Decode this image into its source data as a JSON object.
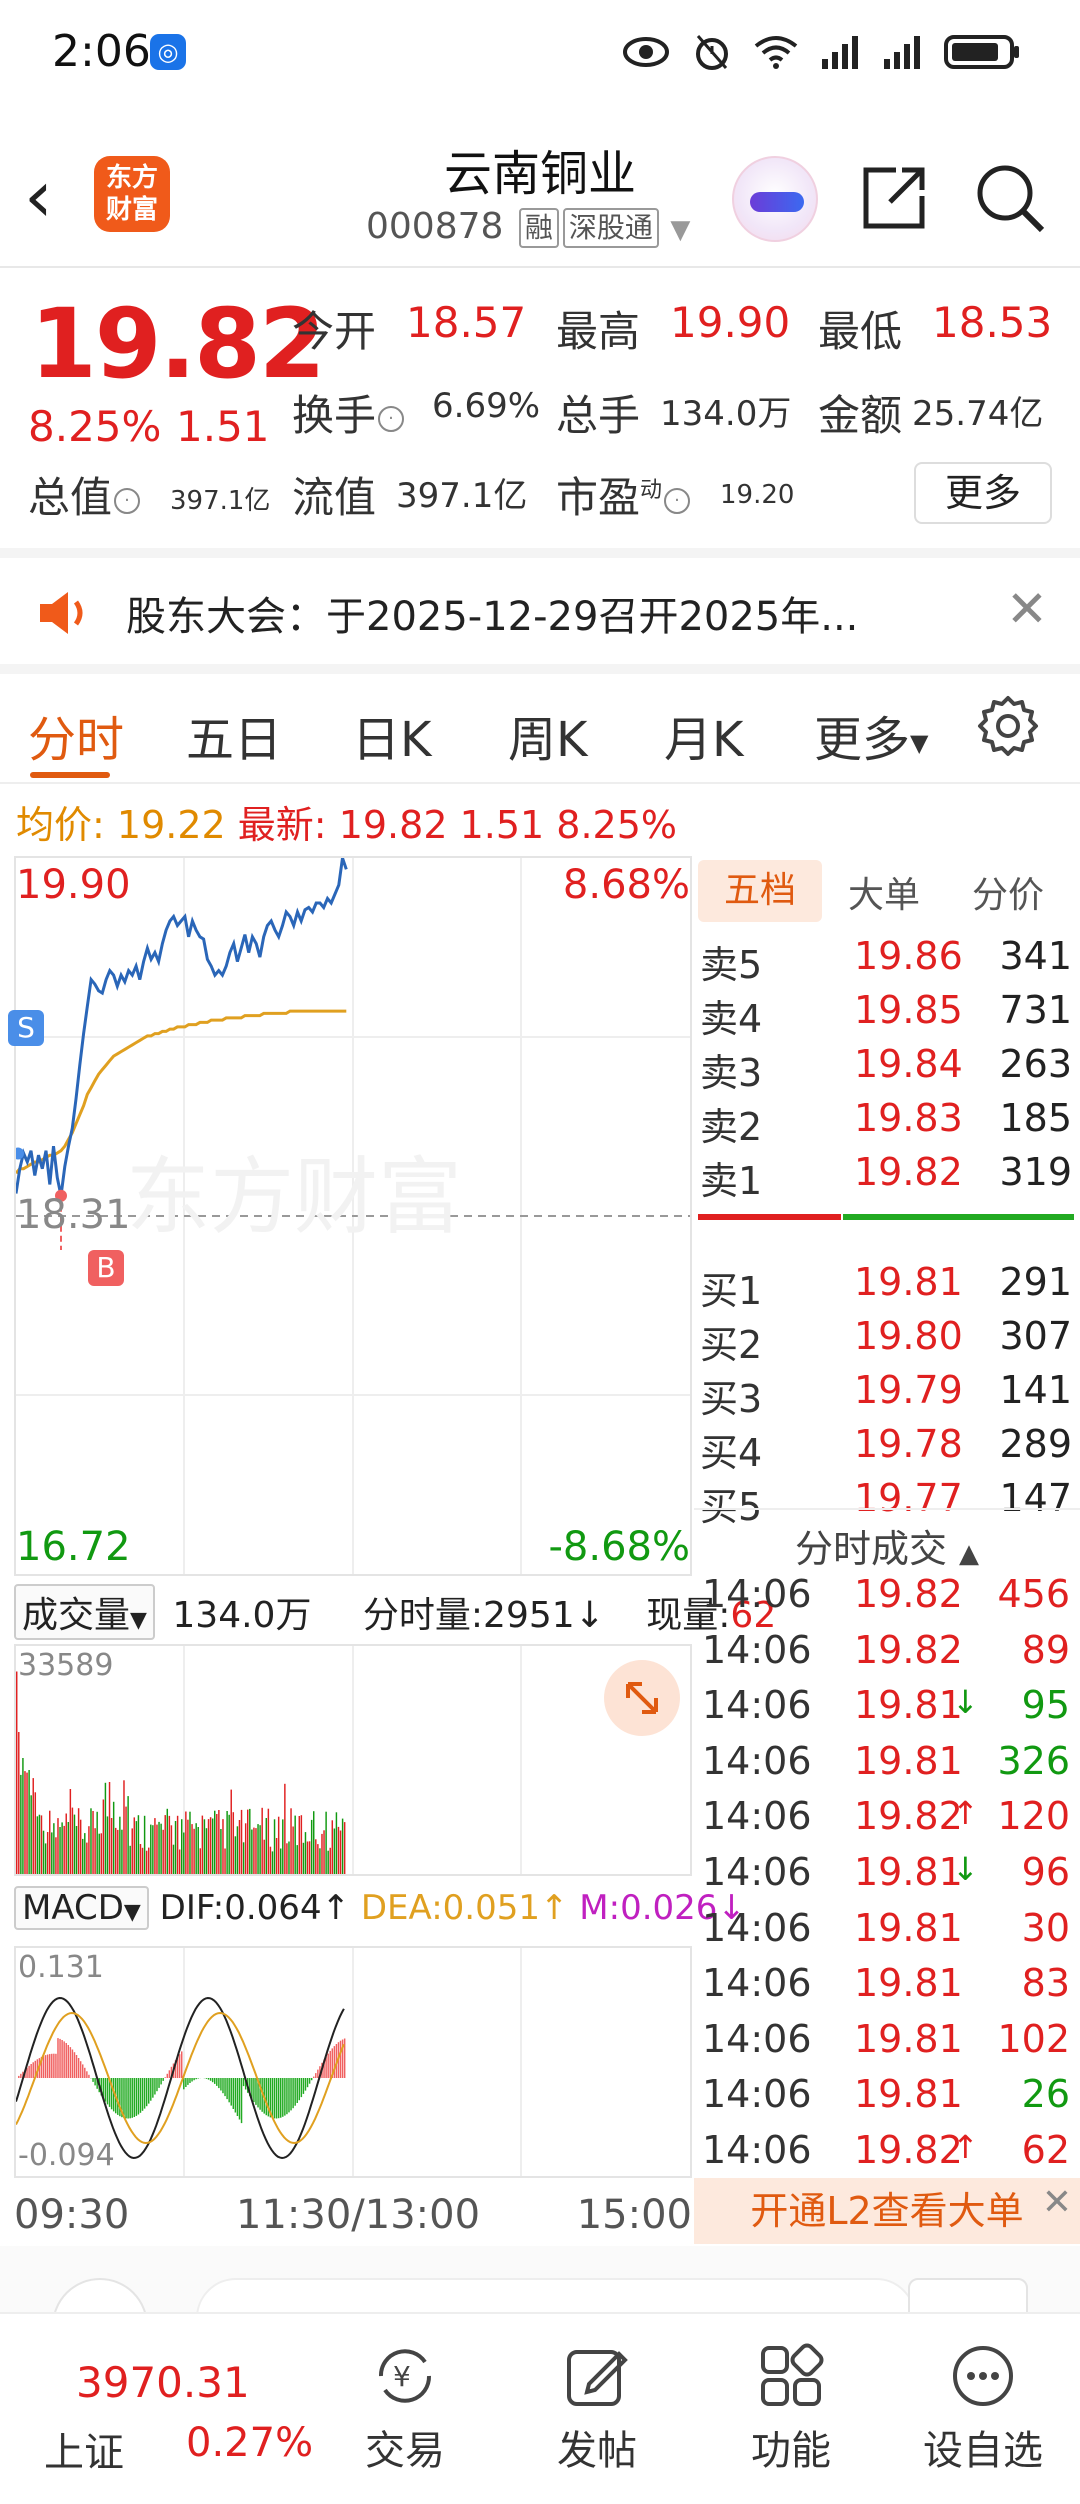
{
  "status": {
    "time": "2:06"
  },
  "header": {
    "stock_name": "云南铜业",
    "stock_code": "000878",
    "tag_margin": "融",
    "tag_connect": "深股通"
  },
  "quote": {
    "price": "19.82",
    "pct": "8.25%",
    "change": "1.51",
    "open_label": "今开",
    "open": "18.57",
    "high_label": "最高",
    "high": "19.90",
    "low_label": "最低",
    "low": "18.53",
    "turnover_label": "换手",
    "turnover": "6.69%",
    "volume_label": "总手",
    "volume": "134.0万",
    "amount_label": "金额",
    "amount": "25.74亿",
    "mktcap_label": "总值",
    "mktcap": "397.1亿",
    "float_label": "流值",
    "float_cap": "397.1亿",
    "pe_label": "市盈",
    "pe_sup": "动",
    "pe": "19.20",
    "more_label": "更多"
  },
  "notice": {
    "text": "股东大会：于2025-12-29召开2025年..."
  },
  "tabs": [
    "分时",
    "五日",
    "日K",
    "周K",
    "月K",
    "更多"
  ],
  "avg_line": {
    "avg_label": "均价:",
    "avg": "19.22",
    "latest_label": "最新:",
    "latest": "19.82",
    "change": "1.51",
    "pct": "8.25%"
  },
  "chart": {
    "y_top": "19.90",
    "y_top_pct": "8.68%",
    "y_mid": "18.31",
    "y_bot": "16.72",
    "y_bot_pct": "-8.68%",
    "watermark": "东方财富",
    "marker_s": "S",
    "marker_b": "B"
  },
  "chart_data": {
    "type": "line",
    "title": "",
    "x_ticks": [
      "09:30",
      "11:30/13:00",
      "15:00"
    ],
    "ylim": [
      16.72,
      19.9
    ],
    "prev_close": 18.31,
    "series": [
      {
        "name": "",
        "values": [
          18.41,
          18.52,
          18.59,
          18.55,
          18.6,
          18.49,
          18.58,
          18.52,
          18.6,
          18.45,
          18.62,
          18.48,
          18.4,
          18.53,
          18.62,
          18.7,
          18.83,
          18.98,
          19.12,
          19.24,
          19.36,
          19.34,
          19.31,
          19.3,
          19.36,
          19.4,
          19.38,
          19.33,
          19.38,
          19.35,
          19.4,
          19.38,
          19.42,
          19.36,
          19.44,
          19.5,
          19.45,
          19.48,
          19.44,
          19.52,
          19.58,
          19.62,
          19.64,
          19.6,
          19.62,
          19.64,
          19.55,
          19.62,
          19.58,
          19.55,
          19.54,
          19.45,
          19.42,
          19.38,
          19.4,
          19.38,
          19.42,
          19.48,
          19.52,
          19.44,
          19.5,
          19.56,
          19.48,
          19.55,
          19.52,
          19.46,
          19.55,
          19.6,
          19.62,
          19.58,
          19.55,
          19.6,
          19.66,
          19.64,
          19.6,
          19.66,
          19.62,
          19.67,
          19.68,
          19.66,
          19.7,
          19.7,
          19.68,
          19.72,
          19.7,
          19.74,
          19.78,
          19.9,
          19.85
        ]
      },
      {
        "name": "均价",
        "values": [
          18.5,
          18.52,
          18.52,
          18.53,
          18.54,
          18.55,
          18.55,
          18.56,
          18.57,
          18.58,
          18.58,
          18.59,
          18.6,
          18.62,
          18.65,
          18.68,
          18.72,
          18.76,
          18.8,
          18.85,
          18.88,
          18.91,
          18.94,
          18.96,
          18.98,
          19.0,
          19.02,
          19.03,
          19.04,
          19.05,
          19.06,
          19.07,
          19.08,
          19.09,
          19.1,
          19.11,
          19.11,
          19.12,
          19.12,
          19.13,
          19.13,
          19.14,
          19.14,
          19.15,
          19.15,
          19.15,
          19.16,
          19.16,
          19.16,
          19.17,
          19.17,
          19.17,
          19.18,
          19.18,
          19.18,
          19.18,
          19.19,
          19.19,
          19.19,
          19.19,
          19.19,
          19.2,
          19.2,
          19.2,
          19.2,
          19.2,
          19.21,
          19.21,
          19.21,
          19.21,
          19.21,
          19.21,
          19.21,
          19.22,
          19.22,
          19.22,
          19.22,
          19.22,
          19.22,
          19.22,
          19.22,
          19.22,
          19.22,
          19.22,
          19.22,
          19.22,
          19.22,
          19.22,
          19.22
        ]
      }
    ],
    "volume": {
      "max_label": "33589"
    },
    "macd": {
      "max_label": "0.131",
      "min_label": "-0.094"
    }
  },
  "volume_header": {
    "dropdown": "成交量",
    "total": "134.0万",
    "minute_vol": "分时量:2951↓",
    "now_label": "现量:",
    "now_val": "62"
  },
  "macd_header": {
    "dropdown": "MACD",
    "dif": "DIF:0.064↑",
    "dea": "DEA:0.051↑",
    "m": "M:0.026↓"
  },
  "book": {
    "tabs": [
      "五档",
      "大单",
      "分价"
    ],
    "asks": [
      {
        "label": "卖5",
        "price": "19.86",
        "qty": "341"
      },
      {
        "label": "卖4",
        "price": "19.85",
        "qty": "731"
      },
      {
        "label": "卖3",
        "price": "19.84",
        "qty": "263"
      },
      {
        "label": "卖2",
        "price": "19.83",
        "qty": "185"
      },
      {
        "label": "卖1",
        "price": "19.82",
        "qty": "319"
      }
    ],
    "bids": [
      {
        "label": "买1",
        "price": "19.81",
        "qty": "291"
      },
      {
        "label": "买2",
        "price": "19.80",
        "qty": "307"
      },
      {
        "label": "买3",
        "price": "19.79",
        "qty": "141"
      },
      {
        "label": "买4",
        "price": "19.78",
        "qty": "289"
      },
      {
        "label": "买5",
        "price": "19.77",
        "qty": "147"
      }
    ],
    "buy_share": 0.38
  },
  "trades": {
    "title": "分时成交",
    "rows": [
      {
        "time": "14:06",
        "price": "19.82",
        "arrow": "",
        "vol": "456",
        "dir": "red"
      },
      {
        "time": "14:06",
        "price": "19.82",
        "arrow": "",
        "vol": "89",
        "dir": "red"
      },
      {
        "time": "14:06",
        "price": "19.81",
        "arrow": "↓",
        "vol": "95",
        "dir": "green"
      },
      {
        "time": "14:06",
        "price": "19.81",
        "arrow": "",
        "vol": "326",
        "dir": "green"
      },
      {
        "time": "14:06",
        "price": "19.82",
        "arrow": "↑",
        "vol": "120",
        "dir": "red"
      },
      {
        "time": "14:06",
        "price": "19.81",
        "arrow": "↓",
        "vol": "96",
        "dir": "red"
      },
      {
        "time": "14:06",
        "price": "19.81",
        "arrow": "",
        "vol": "30",
        "dir": "red"
      },
      {
        "time": "14:06",
        "price": "19.81",
        "arrow": "",
        "vol": "83",
        "dir": "red"
      },
      {
        "time": "14:06",
        "price": "19.81",
        "arrow": "",
        "vol": "102",
        "dir": "red"
      },
      {
        "time": "14:06",
        "price": "19.81",
        "arrow": "",
        "vol": "26",
        "dir": "green"
      },
      {
        "time": "14:06",
        "price": "19.82",
        "arrow": "↑",
        "vol": "62",
        "dir": "red"
      }
    ]
  },
  "l2_banner": "开通L2查看大单",
  "bottom": {
    "index_value": "3970.31",
    "index_name": "上证",
    "index_pct": "0.27%",
    "nav": [
      "交易",
      "发帖",
      "功能",
      "设自选"
    ]
  },
  "colors": {
    "up": "#e02020",
    "down": "#119911",
    "accent": "#e05a10",
    "price_line": "#2a66b8",
    "avg_line": "#e0a020"
  }
}
